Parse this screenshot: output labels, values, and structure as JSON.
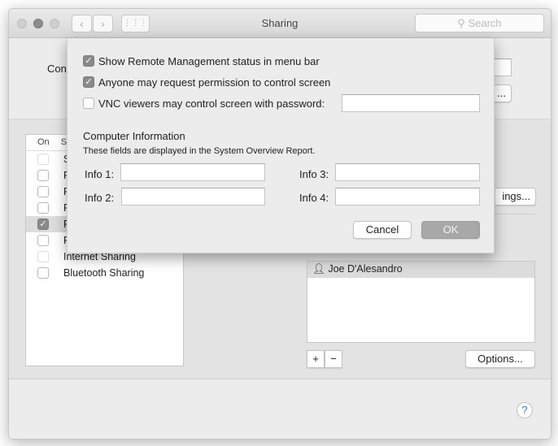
{
  "window": {
    "title": "Sharing",
    "search_placeholder": "Search"
  },
  "background": {
    "computer_name_label_partial": "Con",
    "edit_button_partial": "...",
    "list_header_on": "On",
    "list_header_service_partial": "S",
    "services": [
      {
        "label": "S",
        "checked": false,
        "dim": true
      },
      {
        "label": "F",
        "checked": false
      },
      {
        "label": "F",
        "checked": false
      },
      {
        "label": "F",
        "checked": false
      },
      {
        "label": "F",
        "checked": true,
        "selected": true
      },
      {
        "label": "F",
        "checked": false
      },
      {
        "label": "Internet Sharing",
        "checked": false,
        "dim": true
      },
      {
        "label": "Bluetooth Sharing",
        "checked": false
      }
    ],
    "computer_settings_partial": "ings...",
    "users": [
      "Joe D'Alesandro"
    ],
    "add": "+",
    "remove": "−",
    "options": "Options...",
    "help": "?"
  },
  "sheet": {
    "opt1": {
      "label": "Show Remote Management status in menu bar",
      "checked": true
    },
    "opt2": {
      "label": "Anyone may request permission to control screen",
      "checked": true
    },
    "opt3": {
      "label": "VNC viewers may control screen with password:",
      "checked": false,
      "value": ""
    },
    "info_title": "Computer Information",
    "info_subtitle": "These fields are displayed in the System Overview Report.",
    "info1": "Info 1:",
    "info2": "Info 2:",
    "info3": "Info 3:",
    "info4": "Info 4:",
    "cancel": "Cancel",
    "ok": "OK"
  }
}
